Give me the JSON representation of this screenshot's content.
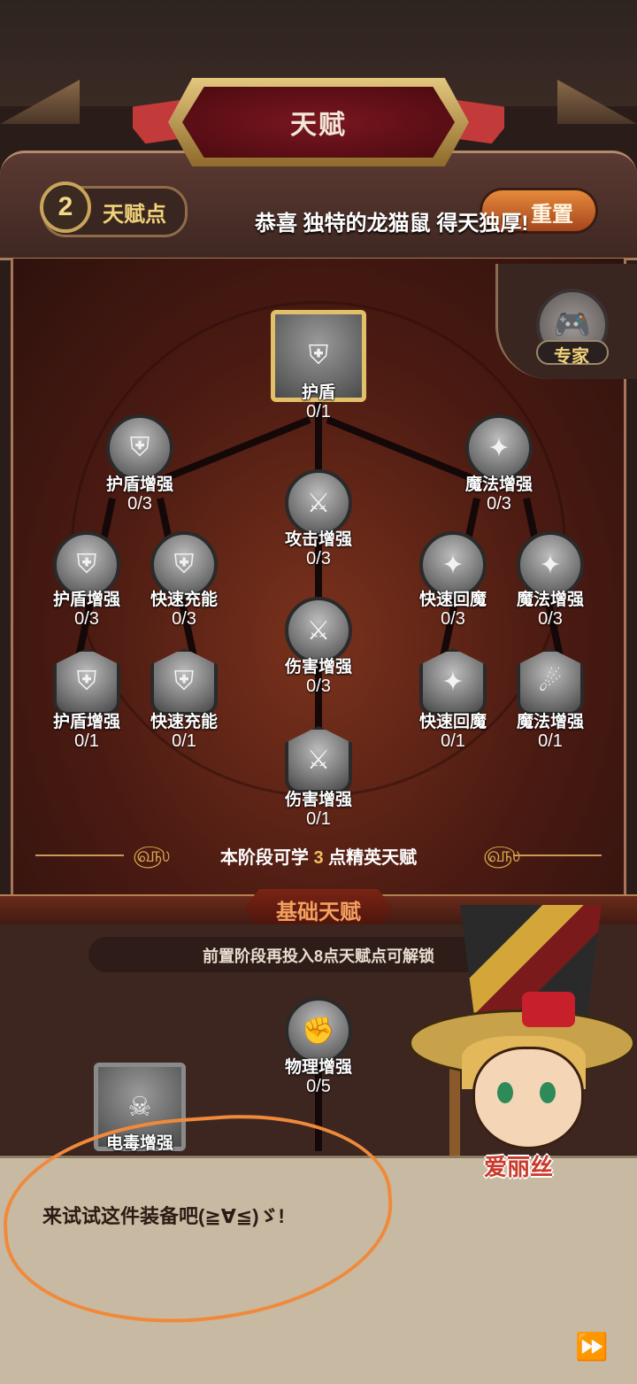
{
  "title": "天赋",
  "header": {
    "talent_points": "2",
    "talent_points_label": "天赋点",
    "congrats_text": "恭喜 独特的龙猫鼠 得天独厚!",
    "reset_label": "重置"
  },
  "expert_tab": {
    "label": "专家",
    "icon": "gamepad-icon"
  },
  "tree": {
    "root": {
      "name": "护盾",
      "count": "0/1",
      "icon": "winged-shield-icon"
    },
    "nodes": [
      {
        "name": "护盾增强",
        "count": "0/3",
        "icon": "shield-plus-icon"
      },
      {
        "name": "攻击增强",
        "count": "0/3",
        "icon": "sword-icon"
      },
      {
        "name": "魔法增强",
        "count": "0/3",
        "icon": "star-burst-icon"
      },
      {
        "name": "护盾增强",
        "count": "0/3",
        "icon": "shield-arrow-icon"
      },
      {
        "name": "快速充能",
        "count": "0/3",
        "icon": "shield-icon"
      },
      {
        "name": "伤害增强",
        "count": "0/3",
        "icon": "sword-arrow-icon"
      },
      {
        "name": "快速回魔",
        "count": "0/3",
        "icon": "star-plus-icon"
      },
      {
        "name": "魔法增强",
        "count": "0/3",
        "icon": "star-arrow-icon"
      },
      {
        "name": "护盾增强",
        "count": "0/1",
        "icon": "shield-arrow-icon"
      },
      {
        "name": "快速充能",
        "count": "0/1",
        "icon": "shield-icon"
      },
      {
        "name": "快速回魔",
        "count": "0/1",
        "icon": "star-plus-icon"
      },
      {
        "name": "魔法增强",
        "count": "0/1",
        "icon": "comet-icon"
      },
      {
        "name": "伤害增强",
        "count": "0/1",
        "icon": "sword-burst-icon"
      }
    ],
    "elite_note": {
      "prefix": "本阶段可学",
      "number": "3",
      "suffix": "点精英天赋"
    }
  },
  "basic": {
    "title": "基础天赋",
    "lock_note": "前置阶段再投入8点天赋点可解锁",
    "nodes": [
      {
        "name": "物理增强",
        "count": "0/5",
        "icon": "fist-icon"
      },
      {
        "name": "电毒增强",
        "icon": "skull-icon"
      }
    ]
  },
  "character": {
    "name": "爱丽丝"
  },
  "dialog": {
    "text": "来试试这件装备吧(≧∀≦)ゞ!"
  },
  "colors": {
    "accent": "#f0c060",
    "scribble": "#f08a3a",
    "title_red": "#7a1620"
  }
}
